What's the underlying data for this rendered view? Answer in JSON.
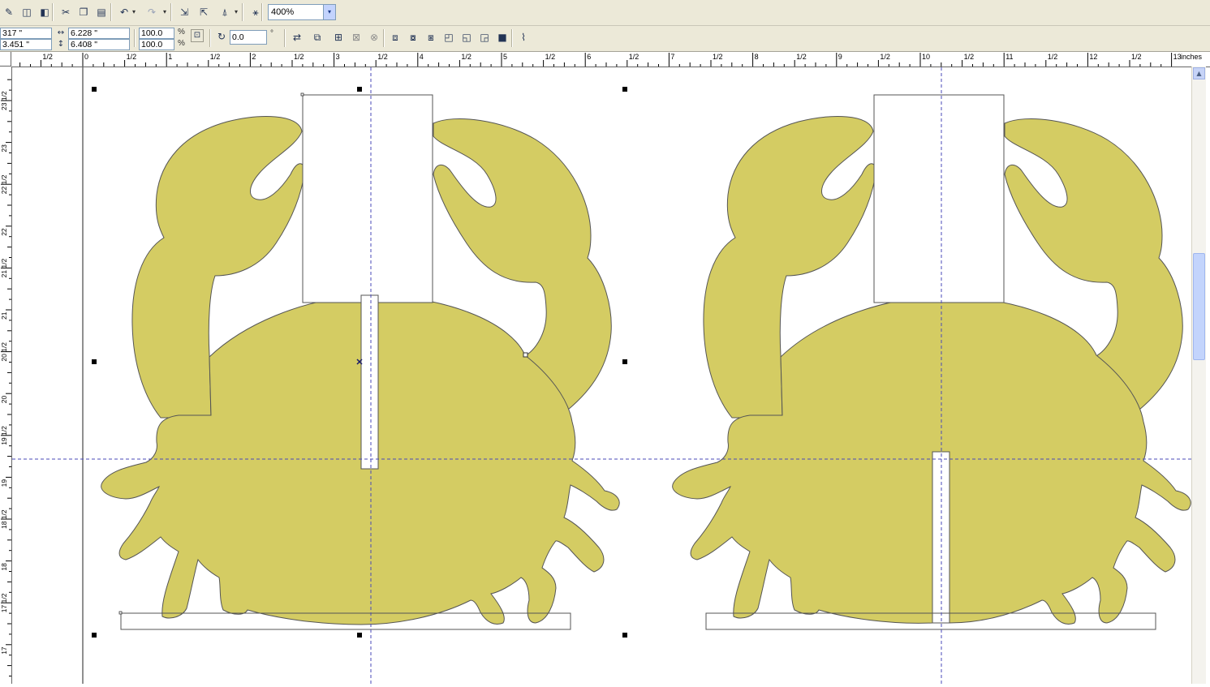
{
  "toolbar": {
    "zoom_value": "400%",
    "zoom_arrow": "▾",
    "buttons": [
      {
        "name": "new-document-icon",
        "glyph": "✎"
      },
      {
        "name": "open-icon",
        "glyph": "◫"
      },
      {
        "name": "save-icon",
        "glyph": "◧"
      },
      {
        "name": "cut-icon",
        "glyph": "✂"
      },
      {
        "name": "copy-icon",
        "glyph": "❐"
      },
      {
        "name": "paste-icon",
        "glyph": "▤"
      },
      {
        "name": "undo-icon",
        "glyph": "↶"
      },
      {
        "name": "redo-icon",
        "glyph": "↷"
      },
      {
        "name": "import-icon",
        "glyph": "⇲"
      },
      {
        "name": "export-icon",
        "glyph": "⇱"
      },
      {
        "name": "application-launcher-icon",
        "glyph": "⍋"
      },
      {
        "name": "welcome-screen-icon",
        "glyph": "⚹"
      }
    ]
  },
  "property_bar": {
    "pos_x": "317 \"",
    "pos_y": "3.451 \"",
    "width": "6.228 \"",
    "height": "6.408 \"",
    "scale_x": "100.0",
    "scale_y": "100.0",
    "percent_x": "%",
    "percent_y": "%",
    "rotation": "0.0",
    "degree": "°"
  },
  "ruler_h": {
    "unit_label": "inches",
    "labels": [
      "1/2",
      "0",
      "1/2",
      "1",
      "1/2",
      "2",
      "1/2",
      "3",
      "1/2",
      "4",
      "1/2",
      "5",
      "1/2",
      "6",
      "1/2",
      "7",
      "1/2",
      "8",
      "1/2",
      "9",
      "1/2",
      "10",
      "1/2",
      "11",
      "1/2",
      "12",
      "1/2",
      "13"
    ]
  },
  "ruler_v": {
    "labels": [
      "23 1/2",
      "23",
      "22 1/2",
      "22",
      "21 1/2",
      "21",
      "20 1/2",
      "20",
      "19 1/2",
      "19",
      "18 1/2",
      "18",
      "17 1/2",
      "17"
    ]
  },
  "colors": {
    "crab_fill": "#d4cc63",
    "outline": "#555555",
    "guide": "#4a4ab8",
    "toolbar_bg": "#ece9d8"
  }
}
